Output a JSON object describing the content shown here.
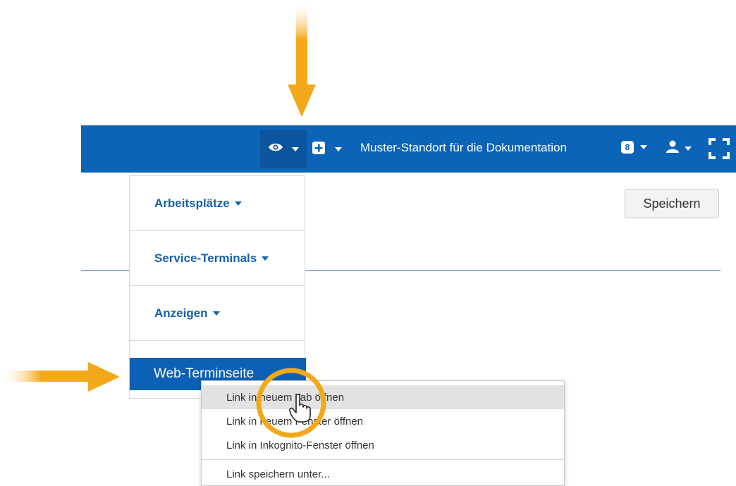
{
  "navbar": {
    "eye_icon": "eye-icon",
    "add_icon": "plus-square-icon",
    "location": "Muster-Standort für die Dokumentation",
    "badge_count": "8",
    "user_icon": "user-icon",
    "fullscreen_icon": "fullscreen-icon",
    "color": "#0b64b8"
  },
  "save_button": {
    "label": "Speichern"
  },
  "dropdown": {
    "items": [
      {
        "label": "Arbeitsplätze"
      },
      {
        "label": "Service-Terminals"
      },
      {
        "label": "Anzeigen"
      }
    ],
    "active_item": {
      "label": "Web-Terminseite"
    }
  },
  "context_menu": {
    "items": [
      {
        "label": "Link in neuem Tab öffnen"
      },
      {
        "label": "Link in neuem Fenster öffnen"
      },
      {
        "label": "Link in Inkognito-Fenster öffnen"
      },
      {
        "label": "Link speichern unter..."
      }
    ]
  },
  "annotations": {
    "accent": "#f2a818"
  }
}
